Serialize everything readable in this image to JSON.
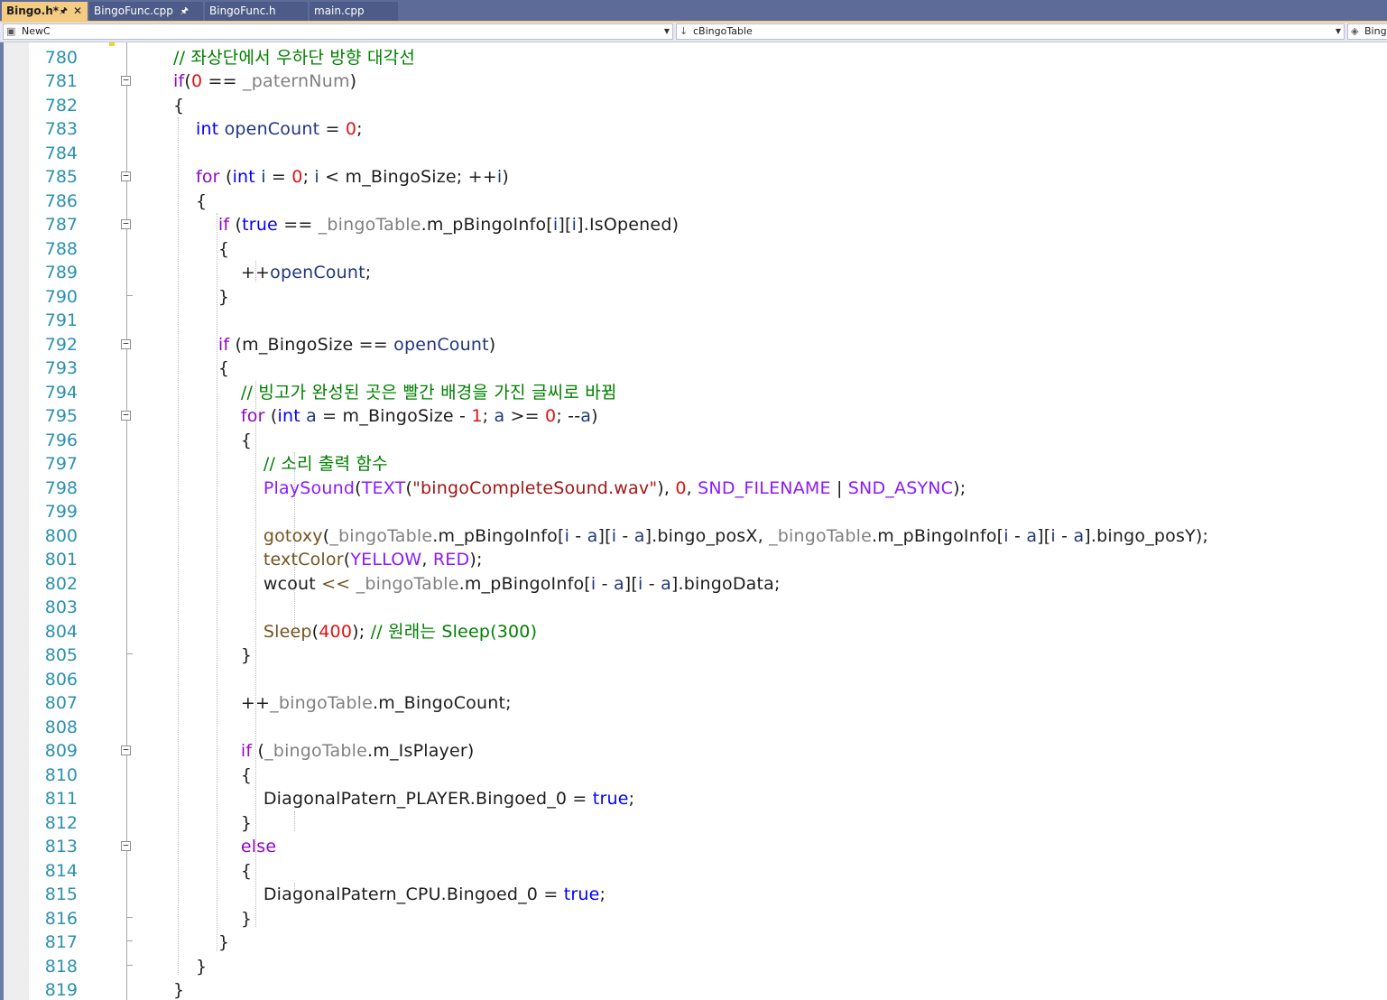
{
  "tabs": [
    {
      "label": "Bingo.h*",
      "active": true,
      "pinned": true,
      "closable": true
    },
    {
      "label": "BingoFunc.cpp",
      "active": false,
      "pinned": true,
      "closable": false
    },
    {
      "label": "BingoFunc.h",
      "active": false,
      "pinned": false,
      "closable": false
    },
    {
      "label": "main.cpp",
      "active": false,
      "pinned": false,
      "closable": false
    }
  ],
  "navbar": {
    "project_combo": "NewC",
    "scope_combo": "cBingoTable",
    "member_combo": "Bing"
  },
  "editor": {
    "line_numbers": [
      "780",
      "781",
      "782",
      "783",
      "784",
      "785",
      "786",
      "787",
      "788",
      "789",
      "790",
      "791",
      "792",
      "793",
      "794",
      "795",
      "796",
      "797",
      "798",
      "799",
      "800",
      "801",
      "802",
      "803",
      "804",
      "805",
      "806",
      "807",
      "808",
      "809",
      "810",
      "811",
      "812",
      "813",
      "814",
      "815",
      "816",
      "817",
      "818",
      "819"
    ],
    "code_lines": [
      [
        {
          "t": "// 좌상단에서 우하단 방향 대각선",
          "c": "com"
        }
      ],
      [
        {
          "t": "if",
          "c": "ctl"
        },
        {
          "t": "(",
          "c": "txt2"
        },
        {
          "t": "0",
          "c": "num"
        },
        {
          "t": " == ",
          "c": "txt2"
        },
        {
          "t": "_paternNum",
          "c": "mem"
        },
        {
          "t": ")",
          "c": "txt2"
        }
      ],
      [
        {
          "t": "{",
          "c": "txt2"
        }
      ],
      [
        {
          "t": "    ",
          "c": "txt2"
        },
        {
          "t": "int",
          "c": "kw"
        },
        {
          "t": " ",
          "c": "txt2"
        },
        {
          "t": "openCount",
          "c": "var"
        },
        {
          "t": " = ",
          "c": "txt2"
        },
        {
          "t": "0",
          "c": "num"
        },
        {
          "t": ";",
          "c": "txt2"
        }
      ],
      [],
      [
        {
          "t": "    ",
          "c": "txt2"
        },
        {
          "t": "for",
          "c": "ctl"
        },
        {
          "t": " (",
          "c": "txt2"
        },
        {
          "t": "int",
          "c": "kw"
        },
        {
          "t": " ",
          "c": "txt2"
        },
        {
          "t": "i",
          "c": "var"
        },
        {
          "t": " = ",
          "c": "txt2"
        },
        {
          "t": "0",
          "c": "num"
        },
        {
          "t": "; ",
          "c": "txt2"
        },
        {
          "t": "i",
          "c": "var"
        },
        {
          "t": " < m_BingoSize; ++",
          "c": "txt2"
        },
        {
          "t": "i",
          "c": "var"
        },
        {
          "t": ")",
          "c": "txt2"
        }
      ],
      [
        {
          "t": "    {",
          "c": "txt2"
        }
      ],
      [
        {
          "t": "        ",
          "c": "txt2"
        },
        {
          "t": "if",
          "c": "ctl"
        },
        {
          "t": " (",
          "c": "txt2"
        },
        {
          "t": "true",
          "c": "kw"
        },
        {
          "t": " == ",
          "c": "txt2"
        },
        {
          "t": "_bingoTable",
          "c": "mem"
        },
        {
          "t": ".m_pBingoInfo[",
          "c": "txt2"
        },
        {
          "t": "i",
          "c": "var"
        },
        {
          "t": "][",
          "c": "txt2"
        },
        {
          "t": "i",
          "c": "var"
        },
        {
          "t": "].IsOpened)",
          "c": "txt2"
        }
      ],
      [
        {
          "t": "        {",
          "c": "txt2"
        }
      ],
      [
        {
          "t": "            ++",
          "c": "txt2"
        },
        {
          "t": "openCount",
          "c": "var"
        },
        {
          "t": ";",
          "c": "txt2"
        }
      ],
      [
        {
          "t": "        }",
          "c": "txt2"
        }
      ],
      [],
      [
        {
          "t": "        ",
          "c": "txt2"
        },
        {
          "t": "if",
          "c": "ctl"
        },
        {
          "t": " (m_BingoSize == ",
          "c": "txt2"
        },
        {
          "t": "openCount",
          "c": "var"
        },
        {
          "t": ")",
          "c": "txt2"
        }
      ],
      [
        {
          "t": "        {",
          "c": "txt2"
        }
      ],
      [
        {
          "t": "            ",
          "c": "txt2"
        },
        {
          "t": "// 빙고가 완성된 곳은 빨간 배경을 가진 글씨로 바뀜",
          "c": "com"
        }
      ],
      [
        {
          "t": "            ",
          "c": "txt2"
        },
        {
          "t": "for",
          "c": "ctl"
        },
        {
          "t": " (",
          "c": "txt2"
        },
        {
          "t": "int",
          "c": "kw"
        },
        {
          "t": " ",
          "c": "txt2"
        },
        {
          "t": "a",
          "c": "var"
        },
        {
          "t": " = m_BingoSize - ",
          "c": "txt2"
        },
        {
          "t": "1",
          "c": "num"
        },
        {
          "t": "; ",
          "c": "txt2"
        },
        {
          "t": "a",
          "c": "var"
        },
        {
          "t": " >= ",
          "c": "txt2"
        },
        {
          "t": "0",
          "c": "num"
        },
        {
          "t": "; --",
          "c": "txt2"
        },
        {
          "t": "a",
          "c": "var"
        },
        {
          "t": ")",
          "c": "txt2"
        }
      ],
      [
        {
          "t": "            {",
          "c": "txt2"
        }
      ],
      [
        {
          "t": "                ",
          "c": "txt2"
        },
        {
          "t": "// 소리 출력 함수",
          "c": "com"
        }
      ],
      [
        {
          "t": "                ",
          "c": "txt2"
        },
        {
          "t": "PlaySound",
          "c": "mac"
        },
        {
          "t": "(",
          "c": "txt2"
        },
        {
          "t": "TEXT",
          "c": "mac"
        },
        {
          "t": "(",
          "c": "txt2"
        },
        {
          "t": "\"bingoCompleteSound.wav\"",
          "c": "str"
        },
        {
          "t": "), ",
          "c": "txt2"
        },
        {
          "t": "0",
          "c": "num"
        },
        {
          "t": ", ",
          "c": "txt2"
        },
        {
          "t": "SND_FILENAME",
          "c": "mac"
        },
        {
          "t": " | ",
          "c": "txt2"
        },
        {
          "t": "SND_ASYNC",
          "c": "mac"
        },
        {
          "t": ");",
          "c": "txt2"
        }
      ],
      [],
      [
        {
          "t": "                ",
          "c": "txt2"
        },
        {
          "t": "gotoxy",
          "c": "fn"
        },
        {
          "t": "(",
          "c": "txt2"
        },
        {
          "t": "_bingoTable",
          "c": "mem"
        },
        {
          "t": ".m_pBingoInfo[",
          "c": "txt2"
        },
        {
          "t": "i",
          "c": "var"
        },
        {
          "t": " - ",
          "c": "txt2"
        },
        {
          "t": "a",
          "c": "var"
        },
        {
          "t": "][",
          "c": "txt2"
        },
        {
          "t": "i",
          "c": "var"
        },
        {
          "t": " - ",
          "c": "txt2"
        },
        {
          "t": "a",
          "c": "var"
        },
        {
          "t": "].bingo_posX, ",
          "c": "txt2"
        },
        {
          "t": "_bingoTable",
          "c": "mem"
        },
        {
          "t": ".m_pBingoInfo[",
          "c": "txt2"
        },
        {
          "t": "i",
          "c": "var"
        },
        {
          "t": " - ",
          "c": "txt2"
        },
        {
          "t": "a",
          "c": "var"
        },
        {
          "t": "][",
          "c": "txt2"
        },
        {
          "t": "i",
          "c": "var"
        },
        {
          "t": " - ",
          "c": "txt2"
        },
        {
          "t": "a",
          "c": "var"
        },
        {
          "t": "].bingo_posY);",
          "c": "txt2"
        }
      ],
      [
        {
          "t": "                ",
          "c": "txt2"
        },
        {
          "t": "textColor",
          "c": "fn"
        },
        {
          "t": "(",
          "c": "txt2"
        },
        {
          "t": "YELLOW",
          "c": "mac"
        },
        {
          "t": ", ",
          "c": "txt2"
        },
        {
          "t": "RED",
          "c": "mac"
        },
        {
          "t": ");",
          "c": "txt2"
        }
      ],
      [
        {
          "t": "                wcout ",
          "c": "txt2"
        },
        {
          "t": "<<",
          "c": "fn"
        },
        {
          "t": " ",
          "c": "txt2"
        },
        {
          "t": "_bingoTable",
          "c": "mem"
        },
        {
          "t": ".m_pBingoInfo[",
          "c": "txt2"
        },
        {
          "t": "i",
          "c": "var"
        },
        {
          "t": " - ",
          "c": "txt2"
        },
        {
          "t": "a",
          "c": "var"
        },
        {
          "t": "][",
          "c": "txt2"
        },
        {
          "t": "i",
          "c": "var"
        },
        {
          "t": " - ",
          "c": "txt2"
        },
        {
          "t": "a",
          "c": "var"
        },
        {
          "t": "].bingoData;",
          "c": "txt2"
        }
      ],
      [],
      [
        {
          "t": "                ",
          "c": "txt2"
        },
        {
          "t": "Sleep",
          "c": "fn"
        },
        {
          "t": "(",
          "c": "txt2"
        },
        {
          "t": "400",
          "c": "num"
        },
        {
          "t": "); ",
          "c": "txt2"
        },
        {
          "t": "// 원래는 Sleep(300)",
          "c": "com"
        }
      ],
      [
        {
          "t": "            }",
          "c": "txt2"
        }
      ],
      [],
      [
        {
          "t": "            ++",
          "c": "txt2"
        },
        {
          "t": "_bingoTable",
          "c": "mem"
        },
        {
          "t": ".m_BingoCount;",
          "c": "txt2"
        }
      ],
      [],
      [
        {
          "t": "            ",
          "c": "txt2"
        },
        {
          "t": "if",
          "c": "ctl"
        },
        {
          "t": " (",
          "c": "txt2"
        },
        {
          "t": "_bingoTable",
          "c": "mem"
        },
        {
          "t": ".m_IsPlayer)",
          "c": "txt2"
        }
      ],
      [
        {
          "t": "            {",
          "c": "txt2"
        }
      ],
      [
        {
          "t": "                DiagonalPatern_PLAYER.Bingoed_0 = ",
          "c": "txt2"
        },
        {
          "t": "true",
          "c": "kw"
        },
        {
          "t": ";",
          "c": "txt2"
        }
      ],
      [
        {
          "t": "            }",
          "c": "txt2"
        }
      ],
      [
        {
          "t": "            ",
          "c": "txt2"
        },
        {
          "t": "else",
          "c": "ctl"
        }
      ],
      [
        {
          "t": "            {",
          "c": "txt2"
        }
      ],
      [
        {
          "t": "                DiagonalPatern_CPU.Bingoed_0 = ",
          "c": "txt2"
        },
        {
          "t": "true",
          "c": "kw"
        },
        {
          "t": ";",
          "c": "txt2"
        }
      ],
      [
        {
          "t": "            }",
          "c": "txt2"
        }
      ],
      [
        {
          "t": "        }",
          "c": "txt2"
        }
      ],
      [
        {
          "t": "    }",
          "c": "txt2"
        }
      ],
      [
        {
          "t": "}",
          "c": "txt2"
        }
      ]
    ],
    "fold_expanders": [
      "781",
      "785",
      "787",
      "792",
      "795",
      "809",
      "813"
    ],
    "fold_ends": [
      "790",
      "805",
      "816",
      "817",
      "818"
    ]
  },
  "colors": {
    "keyword": "#0000ff",
    "control": "#8f08c4",
    "number": "#e01212",
    "string": "#a31515",
    "comment": "#008000",
    "member": "#808080",
    "function": "#74531f",
    "macro": "#8a1bff",
    "local": "#1f377f",
    "line_number": "#2b91af",
    "tab_bar": "#5d6b99",
    "active_tab": "#f5cc84"
  }
}
